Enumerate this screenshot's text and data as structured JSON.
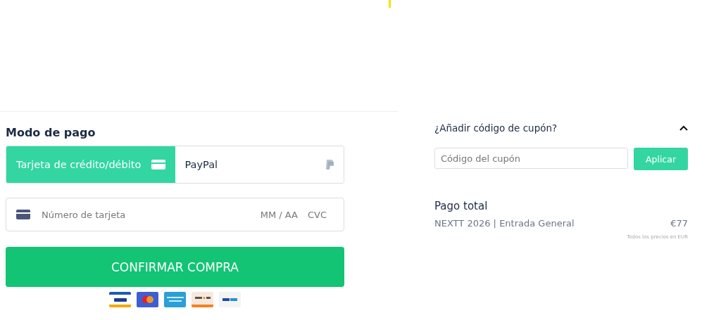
{
  "payment": {
    "title": "Modo de pago",
    "methods": [
      {
        "kind": "card",
        "label": "Tarjeta de crédito/débito",
        "selected": true
      },
      {
        "kind": "paypal",
        "label": "PayPal",
        "selected": false
      }
    ],
    "card_field": {
      "placeholder": "Número de tarjeta",
      "expiry": "MM / AA",
      "cvc": "CVC"
    },
    "submit": "CONFIRMAR COMPRA",
    "logos": [
      {
        "kind": "visa"
      },
      {
        "kind": "mastercard"
      },
      {
        "kind": "amex"
      },
      {
        "kind": "discover"
      },
      {
        "kind": "paypal"
      }
    ]
  },
  "coupon": {
    "title": "¿Añadir código de cupón?",
    "expanded": true,
    "placeholder": "Código del cupón",
    "button": "Aplicar"
  },
  "summary": {
    "title": "Pago total",
    "items": [
      {
        "name": "NEXTT 2026 | Entrada General",
        "price": "€77"
      }
    ],
    "note": "Todos los precios en EUR"
  }
}
